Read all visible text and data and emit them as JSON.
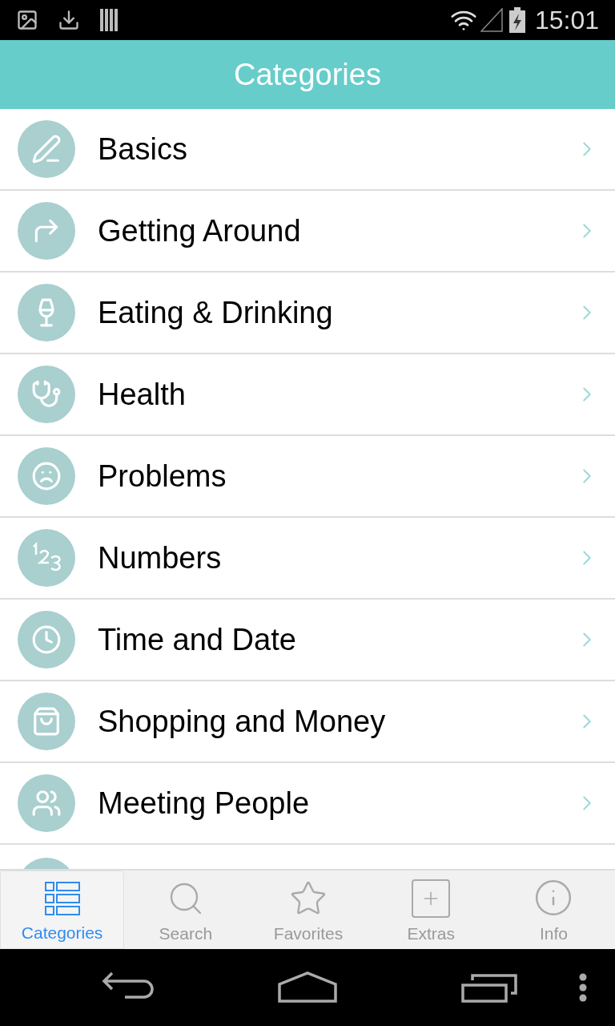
{
  "status_bar": {
    "time": "15:01"
  },
  "header": {
    "title": "Categories"
  },
  "categories": [
    {
      "label": "Basics"
    },
    {
      "label": "Getting Around"
    },
    {
      "label": "Eating & Drinking"
    },
    {
      "label": "Health"
    },
    {
      "label": "Problems"
    },
    {
      "label": "Numbers"
    },
    {
      "label": "Time and Date"
    },
    {
      "label": "Shopping and Money"
    },
    {
      "label": "Meeting People"
    }
  ],
  "tabs": [
    {
      "label": "Categories",
      "selected": true
    },
    {
      "label": "Search",
      "selected": false
    },
    {
      "label": "Favorites",
      "selected": false
    },
    {
      "label": "Extras",
      "selected": false
    },
    {
      "label": "Info",
      "selected": false
    }
  ]
}
